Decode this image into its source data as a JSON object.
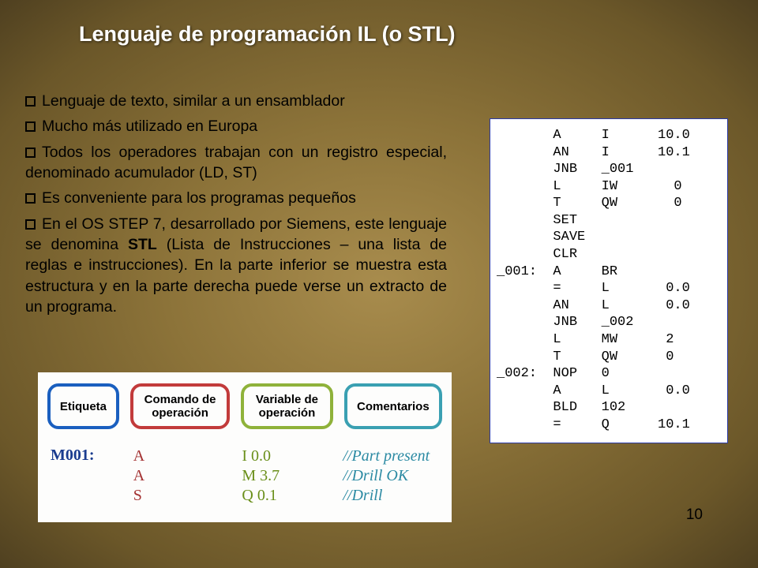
{
  "title": "Lenguaje de programación IL (o STL)",
  "bullets": [
    {
      "text": "Lenguaje de texto, similar a un ensamblador"
    },
    {
      "text": "Mucho más utilizado en Europa"
    },
    {
      "text": "Todos los operadores trabajan con un registro especial, denominado acumulador (LD, ST)"
    },
    {
      "text": "Es conveniente para los programas pequeños"
    }
  ],
  "bullet5_prefix": "En el OS STEP 7, desarrollado por Siemens, este lenguaje se denomina ",
  "bullet5_bold": "STL",
  "bullet5_suffix": " (Lista de Instrucciones – una lista de reglas e instrucciones). En la parte inferior se muestra esta estructura y en la parte derecha puede verse un extracto de un programa.",
  "code_lines": [
    "       A     I      10.0",
    "       AN    I      10.1",
    "       JNB   _001",
    "       L     IW       0",
    "       T     QW       0",
    "       SET",
    "       SAVE",
    "       CLR",
    "_001:  A     BR",
    "       =     L       0.0",
    "       AN    L       0.0",
    "       JNB   _002",
    "       L     MW      2",
    "       T     QW      0",
    "_002:  NOP   0",
    "       A     L       0.0",
    "       BLD   102",
    "       =     Q      10.1"
  ],
  "page_number": "10",
  "figure": {
    "headers": {
      "etiqueta": "Etiqueta",
      "comando": "Comando de operación",
      "variable": "Variable de operación",
      "comentarios": "Comentarios"
    },
    "label": "M001:",
    "cmds": [
      "A",
      "A",
      "S"
    ],
    "vars": [
      "I 0.0",
      "M 3.7",
      "Q 0.1"
    ],
    "comments": [
      "//Part present",
      "//Drill OK",
      "//Drill"
    ]
  }
}
